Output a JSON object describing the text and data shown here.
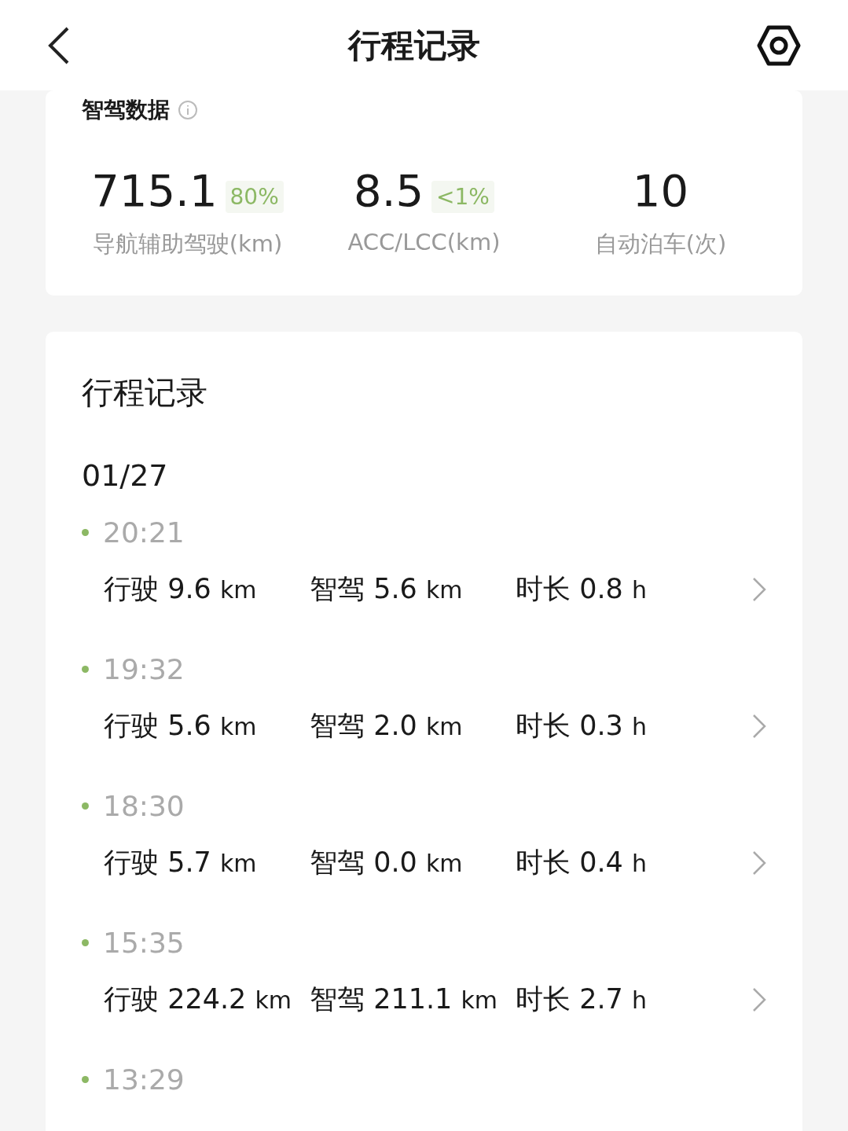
{
  "header": {
    "title": "行程记录"
  },
  "summary": {
    "title": "智驾数据",
    "stats": [
      {
        "value": "715.1",
        "badge": "80%",
        "label": "导航辅助驾驶(km)"
      },
      {
        "value": "8.5",
        "badge": "<1%",
        "label": "ACC/LCC(km)"
      },
      {
        "value": "10",
        "label": "自动泊车(次)"
      }
    ]
  },
  "trips": {
    "title": "行程记录",
    "date": "01/27",
    "items": [
      {
        "time": "20:21",
        "stats": [
          {
            "label": "行驶",
            "value": "9.6",
            "unit": "km"
          },
          {
            "label": "智驾",
            "value": "5.6",
            "unit": "km"
          },
          {
            "label": "时长",
            "value": "0.8",
            "unit": "h"
          }
        ]
      },
      {
        "time": "19:32",
        "stats": [
          {
            "label": "行驶",
            "value": "5.6",
            "unit": "km"
          },
          {
            "label": "智驾",
            "value": "2.0",
            "unit": "km"
          },
          {
            "label": "时长",
            "value": "0.3",
            "unit": "h"
          }
        ]
      },
      {
        "time": "18:30",
        "stats": [
          {
            "label": "行驶",
            "value": "5.7",
            "unit": "km"
          },
          {
            "label": "智驾",
            "value": "0.0",
            "unit": "km"
          },
          {
            "label": "时长",
            "value": "0.4",
            "unit": "h"
          }
        ]
      },
      {
        "time": "15:35",
        "stats": [
          {
            "label": "行驶",
            "value": "224.2",
            "unit": "km"
          },
          {
            "label": "智驾",
            "value": "211.1",
            "unit": "km"
          },
          {
            "label": "时长",
            "value": "2.7",
            "unit": "h"
          }
        ]
      },
      {
        "time": "13:29"
      }
    ]
  }
}
